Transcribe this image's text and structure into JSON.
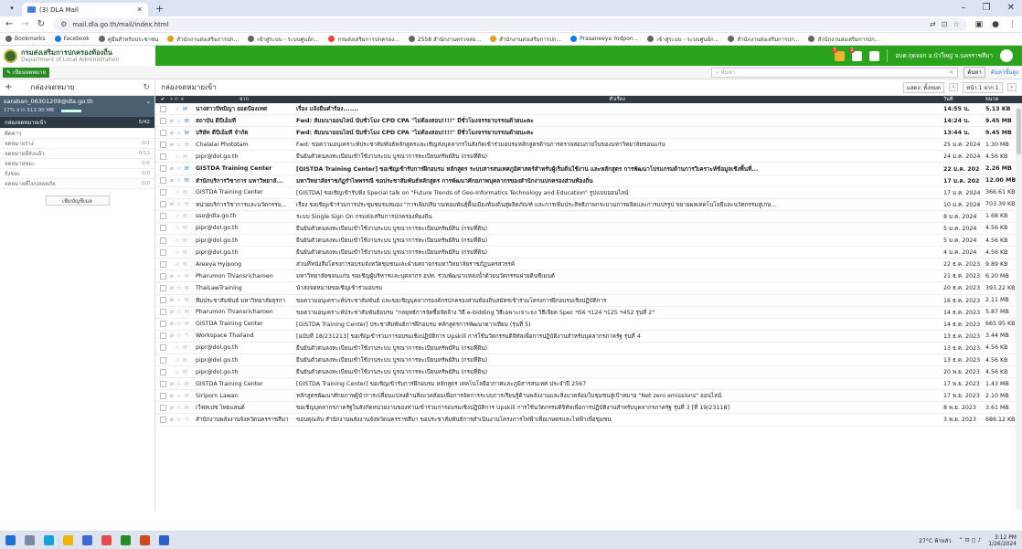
{
  "browser": {
    "tab_title": "(3) DLA Mail",
    "url": "mail.dla.go.th/mail/index.html",
    "bookmarks": [
      {
        "label": "Bookmarks",
        "dot": "gray"
      },
      {
        "label": "Facebook",
        "dot": "fb"
      },
      {
        "label": "คู่มือสำหรับประชาชน",
        "dot": "gray"
      },
      {
        "label": "สำนักงานส่งเสริมการปก...",
        "dot": "st"
      },
      {
        "label": "เข้าสู่ระบบ - ระบบศูนย์ก...",
        "dot": "gray"
      },
      {
        "label": "กรมส่งเสริมการปกครอง...",
        "dot": "gl"
      },
      {
        "label": "2558 สำนักงานตรวจสอ...",
        "dot": "gray"
      },
      {
        "label": "สำนักงานส่งเสริมการปก...",
        "dot": "st"
      },
      {
        "label": "Prasaneeya Yodpon...",
        "dot": "fb"
      },
      {
        "label": "เข้าสู่ระบบ - ระบบศูนย์ก...",
        "dot": "gray"
      },
      {
        "label": "สำนักงานส่งเสริมการปก...",
        "dot": "gray"
      },
      {
        "label": "สำนักงานส่งเสริมการปก...",
        "dot": "gray"
      }
    ]
  },
  "header": {
    "brand_th": "กรมส่งเสริมการปกครองท้องถิ่น",
    "brand_en": "Department of Local Administration",
    "badge1": "3",
    "badge2": "2",
    "user": "อบต.กุดจอก อ.บัวใหญ่ จ.นครราชสีมา"
  },
  "toolbar": {
    "compose": "เขียนจดหมาย",
    "search_placeholder": "ค้นหา",
    "search_button": "ค้นหา",
    "advanced": "ค้นหาขั้นสูง"
  },
  "titles": {
    "folders": "กล่องจดหมาย",
    "inbox": "กล่องจดหมายเข้า",
    "show_filter": "แสดง: ทั้งหมด",
    "page": "หน้า 1 จาก 1"
  },
  "account": {
    "email": "saraban_06301209@dla.go.th",
    "quota": "17% จาก 512.00 MB"
  },
  "folders": [
    {
      "name": "กล่องจดหมายเข้า",
      "count": "5/42",
      "active": true
    },
    {
      "name": "ติดดาว",
      "count": ""
    },
    {
      "name": "จดหมายร่าง",
      "count": "0/1"
    },
    {
      "name": "จดหมายที่ส่งแล้ว",
      "count": "0/11"
    },
    {
      "name": "จดหมายขยะ",
      "count": "0/0"
    },
    {
      "name": "ถังขยะ",
      "count": "0/0"
    },
    {
      "name": "จดหมายที่ไม่ปลอดภัย",
      "count": "0/0"
    }
  ],
  "add_folder": "เพิ่มบัญชีเมล",
  "columns": {
    "from": "จาก",
    "subject": "หัวเรื่อง",
    "date": "วันที่",
    "size": "ขนาด"
  },
  "emails": [
    {
      "from": "นางสาวปัทมิญา ยอดป้องเทศ",
      "subject": "เรื่อง แจ้งยืนคำร้อง.......",
      "date": "14:55 น.",
      "size": "5.13 KB",
      "unread": true,
      "clip": false
    },
    {
      "from": "สถาบัน ดีบีเอ็มที",
      "subject": "Fwd: สัมมนาออนไลน์ นับชั่วโมง CPD CPA \"ไม่ต้องสอบ!!!!\" มีชั่วโมงจรรยาบรรณด้วยนะคะ",
      "date": "14:24 น.",
      "size": "9.45 MB",
      "unread": true,
      "clip": true
    },
    {
      "from": "บริษัท ดีบีเอ็มที จำกัด",
      "subject": "Fwd: สัมมนาออนไลน์ นับชั่วโมง CPD CPA \"ไม่ต้องสอบ!!!!\" มีชั่วโมงจรรยาบรรณด้วยนะคะ",
      "date": "13:44 น.",
      "size": "9.45 MB",
      "unread": true,
      "clip": true
    },
    {
      "from": "Chalalai Phototam",
      "subject": "Fwd: ขอความอนุเคราะห์ประชาสัมพันธ์หลักสูตรและเชิญส่งบุคลากรในสังกัดเข้าร่วมอบรมหลักสูตรด้านการตรวจสอบภายในของมหาวิทยาลัยขอนแก่น",
      "date": "25 ม.ค. 2024",
      "size": "1.30 MB",
      "unread": false,
      "clip": true
    },
    {
      "from": "pipr@dol.go.th",
      "subject": "ยืนยันตัวตนลงทะเบียนเข้าใช้งานระบบ บูรณาการทะเบียนทรัพย์สิน (กรมที่ดิน)",
      "date": "24 ม.ค. 2024",
      "size": "4.56 KB",
      "unread": false,
      "clip": false
    },
    {
      "from": "GISTDA Training Center",
      "subject": "[GISTDA Training Center] ขอเชิญเข้ารับการฝึกอบรม หลักสูตร ระบบสารสนเทศภูมิศาสตร์สำหรับผู้เริ่มต้นใช้งาน และหลักสูตร การพัฒนาโปรแกรมด้านการวิเคราะห์ข้อมูลเชิงพื้นที่...",
      "date": "22 ม.ค. 2024",
      "size": "2.26 MB",
      "unread": true,
      "clip": true
    },
    {
      "from": "สำนักบริการวิชาการ มหาวิทยาลั...",
      "subject": "มหาวิทยาลัยราชภัฏรำไพพรรณี ขอประชาสัมพันธ์หลักสูตร การพัฒนาศักยภาพบุคลากรของสำนักงานปกครองส่วนท้องถิ่น",
      "date": "17 ม.ค. 2024",
      "size": "12.00 MB",
      "unread": true,
      "clip": true
    },
    {
      "from": "GISTDA Training Center",
      "subject": "[GISTDA] ขอเชิญเข้ารับฟัง Special talk on \"Future Trends of Geo-Informatics Technology and Education\" รูปแบบออนไลน์",
      "date": "17 ม.ค. 2024",
      "size": "366.61 KB",
      "unread": false,
      "clip": false
    },
    {
      "from": "หน่วยบริการวิชาการและนวัตกรรม...",
      "subject": "เรื่อง ขอเชิญเข้าร่วมการประชุมชมรมสมอง \"การเพิ่มปริมาณหอมพันธุ์พื้นเมืองท้องถิ่นสู่ผลิตภัณฑ์ และการเพิ่มประสิทธิภาพกระบวนการผลิตและการแปรรูป ขยายผลเทคโนโลยีและนวัตกรรมสู่เกษ...",
      "date": "10 ม.ค. 2024",
      "size": "703.39 KB",
      "unread": false,
      "clip": true
    },
    {
      "from": "sso@dla.go.th",
      "subject": "ระบบ Single Sign On กรมส่งเสริมการปกครองท้องถิ่น",
      "date": "8 ม.ค. 2024",
      "size": "1.68 KB",
      "unread": false,
      "clip": false
    },
    {
      "from": "pipr@dol.go.th",
      "subject": "ยืนยันตัวตนลงทะเบียนเข้าใช้งานระบบ บูรณาการทะเบียนทรัพย์สิน (กรมที่ดิน)",
      "date": "5 ม.ค. 2024",
      "size": "4.56 KB",
      "unread": false,
      "clip": false
    },
    {
      "from": "pipr@dol.go.th",
      "subject": "ยืนยันตัวตนลงทะเบียนเข้าใช้งานระบบ บูรณาการทะเบียนทรัพย์สิน (กรมที่ดิน)",
      "date": "5 ม.ค. 2024",
      "size": "4.56 KB",
      "unread": false,
      "clip": false
    },
    {
      "from": "pipr@dol.go.th",
      "subject": "ยืนยันตัวตนลงทะเบียนเข้าใช้งานระบบ บูรณาการทะเบียนทรัพย์สิน (กรมที่ดิน)",
      "date": "4 ม.ค. 2024",
      "size": "4.56 KB",
      "unread": false,
      "clip": false
    },
    {
      "from": "Areeya Hyipong",
      "subject": "ส่วนที่หนังสือโครงการอบรมจังหวัดชุมชนและฝ่ายสถาจกรมหาวิทยาลัยราชภัฏนครสวรรค์",
      "date": "22 ธ.ค. 2023",
      "size": "9.89 KB",
      "unread": false,
      "clip": false
    },
    {
      "from": "Pharumon Thiansricharoen",
      "subject": "มหาวิทยาลัยขอนแก่น ขอเชิญผู้บริหารและบุคลากร อปท. ร่วมพัฒนาแหล่งน้ำด้วยนวัตกรรมฝายดินซีเมนต์",
      "date": "21 ธ.ค. 2023",
      "size": "6.20 MB",
      "unread": false,
      "clip": true
    },
    {
      "from": "ThaiLawTraining",
      "subject": "นำส่งจดหมายขอเชิญเข้าร่วมอบรม",
      "date": "20 ธ.ค. 2023",
      "size": "393.22 KB",
      "unread": false,
      "clip": true
    },
    {
      "from": "ทีมประชาสัมพันธ์ มหาวิทยาลัยธุรกา",
      "subject": "ขอความอนุเคราะห์ประชาสัมพันธ์ และขอเชิญบุคลากรองค์กรปกครองส่วนท้องถิ่นสมัครเข้าร่วมโครงการฝึกอบรมเชิงปฏิบัติการ",
      "date": "16 ธ.ค. 2023",
      "size": "2.11 MB",
      "unread": false,
      "clip": true
    },
    {
      "from": "Pharumon Thiansricharoen",
      "subject": "ขอความอนุเคราะห์ประชาสัมพันธ์อบรม \"กลยุทธ์การจัดซื้อจัดจ้าง วิธี e-bidding วิธีเฉพาะเจาะจง วิธีเจียด Spec ฯ56 ฯ124 ฯ125 ฯ452 รุ่นที่ 2\"",
      "date": "14 ธ.ค. 2023",
      "size": "5.87 MB",
      "unread": false,
      "clip": true
    },
    {
      "from": "GISTDA Training Center",
      "subject": "[GISTDA Training Center] ประชาสัมพันธ์การฝึกอบรม หลักสูตรการพัฒนาดาวเทียม (รุ่นที่ 5)",
      "date": "14 ธ.ค. 2023",
      "size": "665.95 KB",
      "unread": false,
      "clip": true
    },
    {
      "from": "Workspace Thailand",
      "subject": "[ฉบับที่ 18/231213] ขอเชิญเข้าร่วมการอบรมเชิงปฏิบัติการ Upskill การใช้นวัตกรรมดิจิทัลเพื่อการปฏิบัติงานสำหรับบุคลากรภาครัฐ รุ่นที่ 4",
      "date": "13 ธ.ค. 2023",
      "size": "3.44 MB",
      "unread": false,
      "clip": true,
      "reply": true
    },
    {
      "from": "pipr@dol.go.th",
      "subject": "ยืนยันตัวตนลงทะเบียนเข้าใช้งานระบบ บูรณาการทะเบียนทรัพย์สิน (กรมที่ดิน)",
      "date": "13 ธ.ค. 2023",
      "size": "4.56 KB",
      "unread": false,
      "clip": false
    },
    {
      "from": "pipr@dol.go.th",
      "subject": "ยืนยันตัวตนลงทะเบียนเข้าใช้งานระบบ บูรณาการทะเบียนทรัพย์สิน (กรมที่ดิน)",
      "date": "13 ธ.ค. 2023",
      "size": "4.56 KB",
      "unread": false,
      "clip": false
    },
    {
      "from": "pipr@dol.go.th",
      "subject": "ยืนยันตัวตนลงทะเบียนเข้าใช้งานระบบ บูรณาการทะเบียนทรัพย์สิน (กรมที่ดิน)",
      "date": "20 พ.ย. 2023",
      "size": "4.56 KB",
      "unread": false,
      "clip": false
    },
    {
      "from": "GISTDA Training Center",
      "subject": "[GISTDA Training Center] ขอเชิญเข้ารับการฝึกอบรม หลักสูตร เทคโนโลยีอวกาศและภูมิสารสนเทศ ประจำปี 2567",
      "date": "17 พ.ย. 2023",
      "size": "1.43 MB",
      "unread": false,
      "clip": true
    },
    {
      "from": "Siriporn Lawan",
      "subject": "หลักสูตรพัฒนาศักยภาพผู้นำการเปลี่ยนแปลงด้านสิ่งแวดล้อมเพื่อการจัดการระบบการเรียนรู้ด้านพลังงานและสิ่งแวดล้อมในชุมชนสู่เป้าหมาย \"Net zero emissions\" ออนไลน์",
      "date": "17 พ.ย. 2023",
      "size": "2.10 MB",
      "unread": false,
      "clip": true
    },
    {
      "from": "เว็ฟสเปซ ไทยแลนด์",
      "subject": "ขอเชิญบุคลากรภาครัฐในสังกัดหน่วยงานของท่านเข้าร่วมการอบรมเชิงปฏิบัติการ Upskill การใช้นวัตกรรมดิจิทัลเพื่อการปฏิบัติงานสำหรับบุคลากรภาครัฐ รุ่นที่ 3 [ที่ 19/23118]",
      "date": "8 พ.ย. 2023",
      "size": "3.61 MB",
      "unread": false,
      "clip": true
    },
    {
      "from": "สำนักงานพลังงานจังหวัดนครราชสีมา",
      "subject": "ขอบคุณลับ สำนักงานพลังงานจังหวัดนครราชสีมา ขอประชาสัมพันธ์การดำเนินงานโครงการไฟฟ้าเพื่อเกษตรและไฟฟ้าเพื่อชุมชน",
      "date": "3 พ.ย. 2023",
      "size": "686.12 KB",
      "unread": false,
      "clip": true,
      "reply": true
    }
  ],
  "taskbar": {
    "weather": "27°C ฟ้าหลัว",
    "time": "3:12 PM",
    "date": "1/26/2024"
  },
  "colors": {
    "green": "#2aa41c",
    "dark": "#2d3a44",
    "accent": "#3a7bd5"
  }
}
